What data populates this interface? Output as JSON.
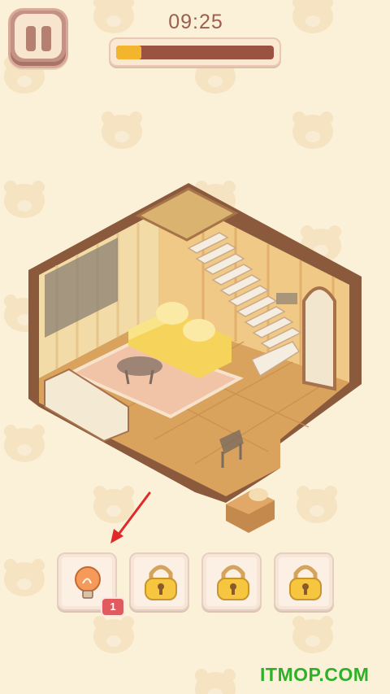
{
  "timer": {
    "time_text": "09:25",
    "progress_fraction": 0.16
  },
  "colors": {
    "background": "#fbf0d8",
    "progress_fill": "#f3b42e",
    "progress_track": "#9a5340",
    "badge": "#e05a5e",
    "arrow": "#e02a2a"
  },
  "toolbar": {
    "slots": [
      {
        "icon": "lightbulb-icon",
        "locked": false,
        "count": "1"
      },
      {
        "icon": "padlock-icon",
        "locked": true
      },
      {
        "icon": "padlock-icon",
        "locked": true
      },
      {
        "icon": "padlock-icon",
        "locked": true
      }
    ]
  },
  "watermark": {
    "text": "ITMOP.COM"
  }
}
